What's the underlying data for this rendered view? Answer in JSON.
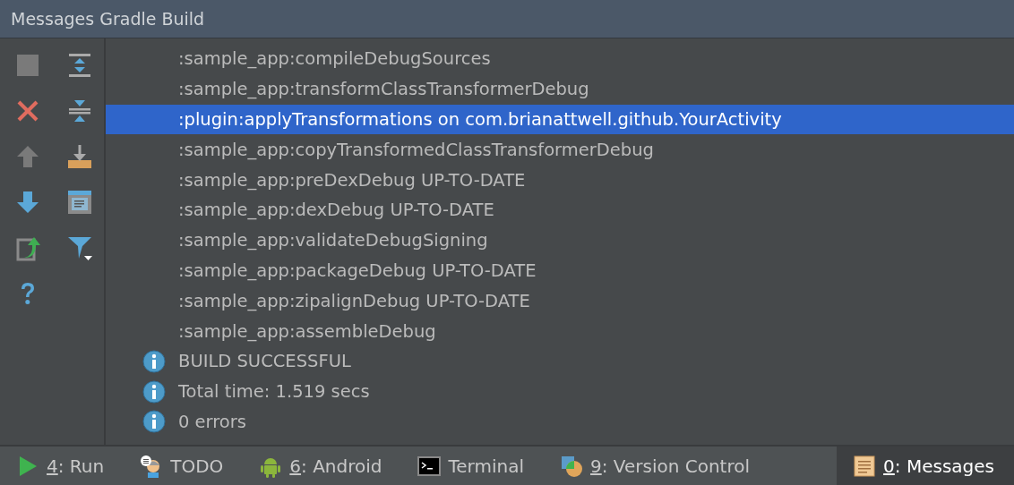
{
  "window": {
    "title": "Messages Gradle Build"
  },
  "toolbar": [
    {
      "disabled": true
    },
    {
      "disabled": false
    },
    {
      "disabled": false
    },
    {
      "disabled": false
    },
    {
      "disabled": true
    },
    {
      "disabled": false
    },
    {
      "disabled": false
    },
    {
      "disabled": false
    },
    {
      "disabled": false
    },
    {
      "disabled": false
    },
    {
      "disabled": false
    }
  ],
  "messages": [
    {
      "kind": "plain",
      "text": ":sample_app:compileDebugSources",
      "selected": false
    },
    {
      "kind": "plain",
      "text": ":sample_app:transformClassTransformerDebug",
      "selected": false
    },
    {
      "kind": "plain",
      "text": ":plugin:applyTransformations on com.brianattwell.github.YourActivity",
      "selected": true
    },
    {
      "kind": "plain",
      "text": ":sample_app:copyTransformedClassTransformerDebug",
      "selected": false
    },
    {
      "kind": "plain",
      "text": ":sample_app:preDexDebug UP-TO-DATE",
      "selected": false
    },
    {
      "kind": "plain",
      "text": ":sample_app:dexDebug UP-TO-DATE",
      "selected": false
    },
    {
      "kind": "plain",
      "text": ":sample_app:validateDebugSigning",
      "selected": false
    },
    {
      "kind": "plain",
      "text": ":sample_app:packageDebug UP-TO-DATE",
      "selected": false
    },
    {
      "kind": "plain",
      "text": ":sample_app:zipalignDebug UP-TO-DATE",
      "selected": false
    },
    {
      "kind": "plain",
      "text": ":sample_app:assembleDebug",
      "selected": false
    },
    {
      "kind": "info",
      "text": "BUILD SUCCESSFUL",
      "selected": false
    },
    {
      "kind": "info",
      "text": "Total time: 1.519 secs",
      "selected": false
    },
    {
      "kind": "info",
      "text": "0 errors",
      "selected": false
    }
  ],
  "tool_tabs": [
    {
      "label": "4: Run",
      "mnemonic": true,
      "selected": false
    },
    {
      "label": "TODO",
      "mnemonic": false,
      "selected": false
    },
    {
      "label": "6: Android",
      "mnemonic": true,
      "selected": false
    },
    {
      "label": "Terminal",
      "mnemonic": false,
      "selected": false
    },
    {
      "label": "9: Version Control",
      "mnemonic": true,
      "selected": false
    },
    {
      "label": "0: Messages",
      "mnemonic": true,
      "selected": true
    }
  ]
}
